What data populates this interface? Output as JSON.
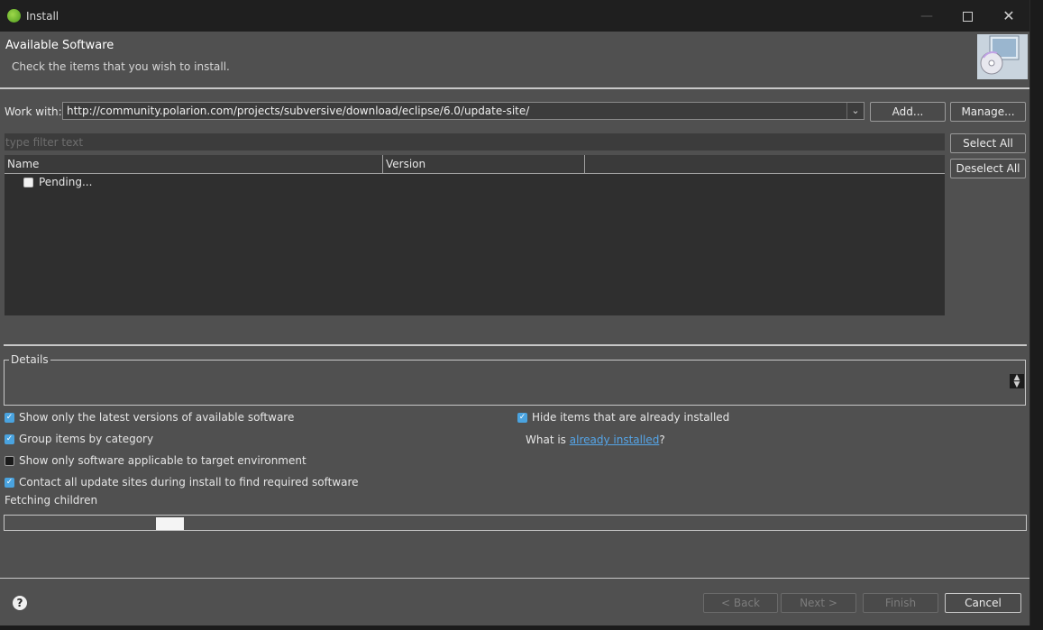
{
  "window": {
    "title": "Install"
  },
  "header": {
    "title": "Available Software",
    "subtitle": "Check the items that you wish to install."
  },
  "work_with": {
    "label": "Work with:",
    "url": "http://community.polarion.com/projects/subversive/download/eclipse/6.0/update-site/",
    "add_label": "Add...",
    "manage_label": "Manage..."
  },
  "filter": {
    "placeholder": "type filter text"
  },
  "table": {
    "columns": [
      "Name",
      "Version",
      ""
    ],
    "rows": [
      {
        "name": "Pending...",
        "version": "",
        "checked": false
      }
    ]
  },
  "side_buttons": {
    "select_all": "Select All",
    "deselect_all": "Deselect All"
  },
  "details": {
    "legend": "Details"
  },
  "options": {
    "latest_versions": {
      "label": "Show only the latest versions of available software",
      "checked": true
    },
    "group_by_category": {
      "label": "Group items by category",
      "checked": true
    },
    "target_env": {
      "label": "Show only software applicable to target environment",
      "checked": false
    },
    "contact_sites": {
      "label": "Contact all update sites during install to find required software",
      "checked": true
    },
    "hide_installed": {
      "label": "Hide items that are already installed",
      "checked": true
    },
    "what_is_prefix": "What is",
    "what_is_link": "already installed",
    "what_is_suffix": "?"
  },
  "status": {
    "text": "Fetching children"
  },
  "footer": {
    "back": "< Back",
    "next": "Next >",
    "finish": "Finish",
    "cancel": "Cancel"
  },
  "icons": {
    "help": "help-icon",
    "app": "spring-leaf-icon",
    "banner": "install-cd-icon"
  }
}
